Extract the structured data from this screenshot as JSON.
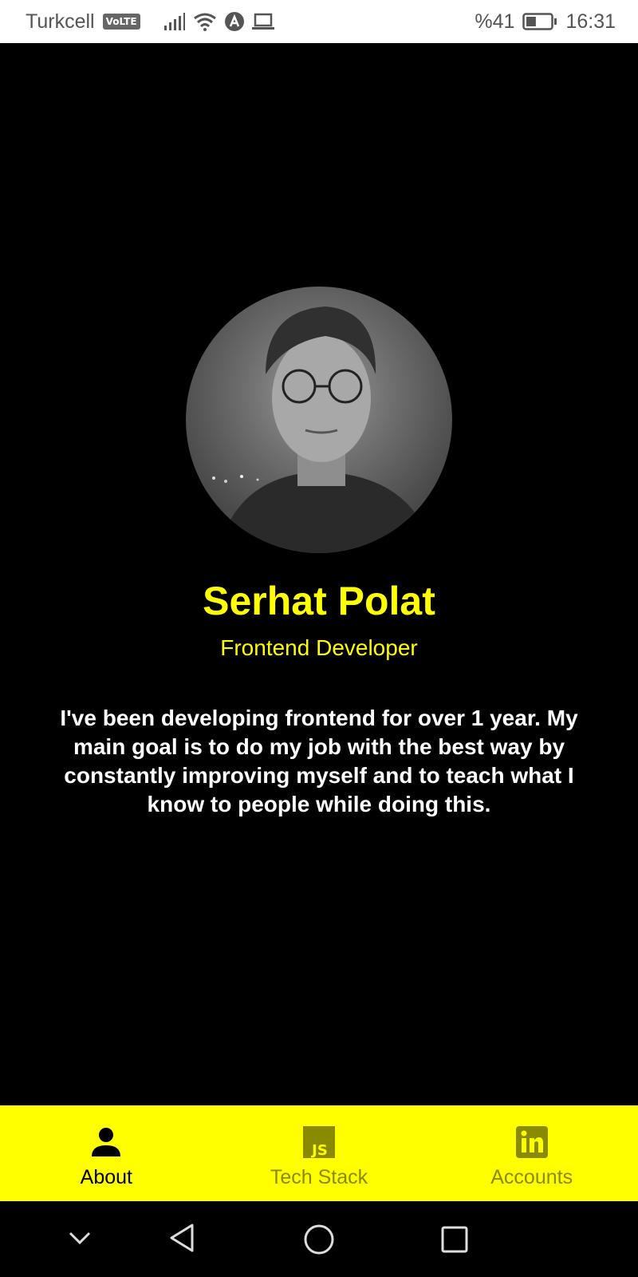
{
  "status_bar": {
    "carrier": "Turkcell",
    "volte": "VoLTE",
    "battery_percent": "%41",
    "time": "16:31",
    "battery_level": 0.41
  },
  "profile": {
    "name": "Serhat Polat",
    "role": "Frontend Developer",
    "bio": "I've been developing frontend for over 1 year. My main goal is to do my job with the best way by constantly improving myself and to teach what I know to people while doing this."
  },
  "tabs": [
    {
      "label": "About",
      "icon": "person-icon",
      "active": true
    },
    {
      "label": "Tech Stack",
      "icon": "js-icon",
      "active": false
    },
    {
      "label": "Accounts",
      "icon": "linkedin-icon",
      "active": false
    }
  ],
  "colors": {
    "accent": "#ffff00",
    "background": "#000000",
    "inactive_tab": "#8a8a00"
  }
}
